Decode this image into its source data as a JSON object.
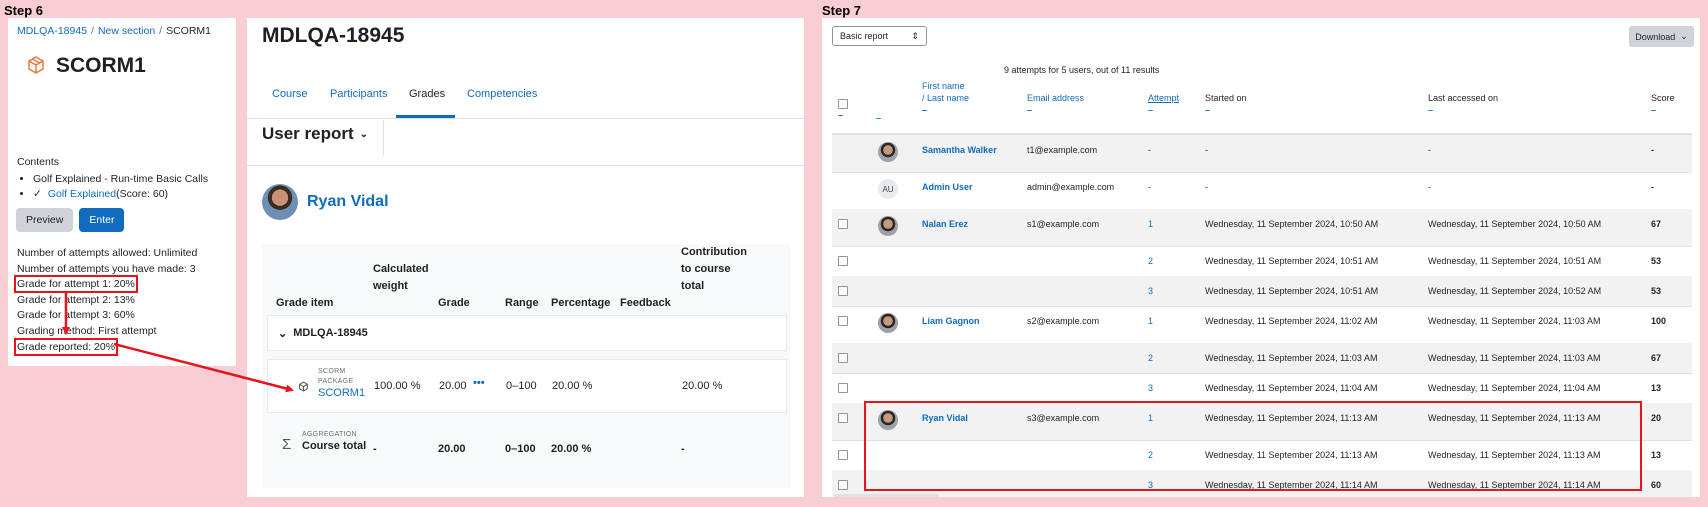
{
  "steps": {
    "step6": "Step 6",
    "step7": "Step 7"
  },
  "scorm_panel": {
    "breadcrumb": [
      "MDLQA-18945",
      "New section",
      "SCORM1"
    ],
    "breadcrumb_sep": "/",
    "title": "SCORM1",
    "contents_label": "Contents",
    "items": [
      "Golf Explained - Run-time Basic Calls",
      "Golf Explained",
      "(Score: 60)"
    ],
    "preview_label": "Preview",
    "enter_label": "Enter",
    "info": [
      "Number of attempts allowed: Unlimited",
      "Number of attempts you have made: 3",
      "Grade for attempt 1: 20%",
      "Grade for attempt 2: 13%",
      "Grade for attempt 3: 60%",
      "Grading method: First attempt",
      "Grade reported: 20%"
    ]
  },
  "grades_panel": {
    "course_title": "MDLQA-18945",
    "tabs": [
      "Course",
      "Participants",
      "Grades",
      "Competencies"
    ],
    "active_tab": "Grades",
    "report_selector": "User report",
    "user_name": "Ryan Vidal",
    "headers": {
      "item": "Grade item",
      "weight_1": "Calculated",
      "weight_2": "weight",
      "grade": "Grade",
      "range": "Range",
      "percentage": "Percentage",
      "feedback": "Feedback",
      "contrib_1": "Contribution",
      "contrib_2": "to course",
      "contrib_3": "total"
    },
    "category": "MDLQA-18945",
    "scorm_row": {
      "type_1": "SCORM",
      "type_2": "PACKAGE",
      "name": "SCORM1",
      "weight": "100.00 %",
      "grade": "20.00",
      "range": "0–100",
      "percentage": "20.00 %",
      "contribution": "20.00 %"
    },
    "total_row": {
      "type": "AGGREGATION",
      "name": "Course total",
      "weight": "-",
      "grade": "20.00",
      "range": "0–100",
      "percentage": "20.00 %",
      "contribution": "-"
    }
  },
  "attempts_panel": {
    "report_select": "Basic report",
    "download_label": "Download",
    "summary": "9 attempts for 5 users, out of 11 results",
    "headers": {
      "first_name": "First name",
      "last_name": "/ Last name",
      "email": "Email address",
      "attempt": "Attempt",
      "started": "Started on",
      "last_accessed": "Last accessed on",
      "score": "Score"
    },
    "rows": [
      {
        "cb": false,
        "avatar": "photo",
        "name": "Samantha Walker",
        "email": "t1@example.com",
        "attempt": "-",
        "started": "-",
        "last": "-",
        "score": "-"
      },
      {
        "cb": false,
        "avatar": "AU",
        "name": "Admin User",
        "email": "admin@example.com",
        "attempt": "-",
        "started": "-",
        "last": "-",
        "score": "-"
      },
      {
        "cb": true,
        "avatar": "photo",
        "name": "Nalan Erez",
        "email": "s1@example.com",
        "attempt": "1",
        "started": "Wednesday, 11 September 2024, 10:50 AM",
        "last": "Wednesday, 11 September 2024, 10:50 AM",
        "score": "67"
      },
      {
        "cb": true,
        "avatar": "",
        "name": "",
        "email": "",
        "attempt": "2",
        "started": "Wednesday, 11 September 2024, 10:51 AM",
        "last": "Wednesday, 11 September 2024, 10:51 AM",
        "score": "53"
      },
      {
        "cb": true,
        "avatar": "",
        "name": "",
        "email": "",
        "attempt": "3",
        "started": "Wednesday, 11 September 2024, 10:51 AM",
        "last": "Wednesday, 11 September 2024, 10:52 AM",
        "score": "53"
      },
      {
        "cb": true,
        "avatar": "photo",
        "name": "Liam Gagnon",
        "email": "s2@example.com",
        "attempt": "1",
        "started": "Wednesday, 11 September 2024, 11:02 AM",
        "last": "Wednesday, 11 September 2024, 11:03 AM",
        "score": "100"
      },
      {
        "cb": true,
        "avatar": "",
        "name": "",
        "email": "",
        "attempt": "2",
        "started": "Wednesday, 11 September 2024, 11:03 AM",
        "last": "Wednesday, 11 September 2024, 11:03 AM",
        "score": "67"
      },
      {
        "cb": true,
        "avatar": "",
        "name": "",
        "email": "",
        "attempt": "3",
        "started": "Wednesday, 11 September 2024, 11:04 AM",
        "last": "Wednesday, 11 September 2024, 11:04 AM",
        "score": "13"
      },
      {
        "cb": true,
        "avatar": "photo",
        "name": "Ryan Vidal",
        "email": "s3@example.com",
        "attempt": "1",
        "started": "Wednesday, 11 September 2024, 11:13 AM",
        "last": "Wednesday, 11 September 2024, 11:13 AM",
        "score": "20"
      },
      {
        "cb": true,
        "avatar": "",
        "name": "",
        "email": "",
        "attempt": "2",
        "started": "Wednesday, 11 September 2024, 11:13 AM",
        "last": "Wednesday, 11 September 2024, 11:13 AM",
        "score": "13"
      },
      {
        "cb": true,
        "avatar": "",
        "name": "",
        "email": "",
        "attempt": "3",
        "started": "Wednesday, 11 September 2024, 11:14 AM",
        "last": "Wednesday, 11 September 2024, 11:14 AM",
        "score": "60"
      }
    ]
  },
  "colors": {
    "link": "#0f6cbf",
    "highlight": "#e8131b",
    "background": "#f8cdd3"
  }
}
